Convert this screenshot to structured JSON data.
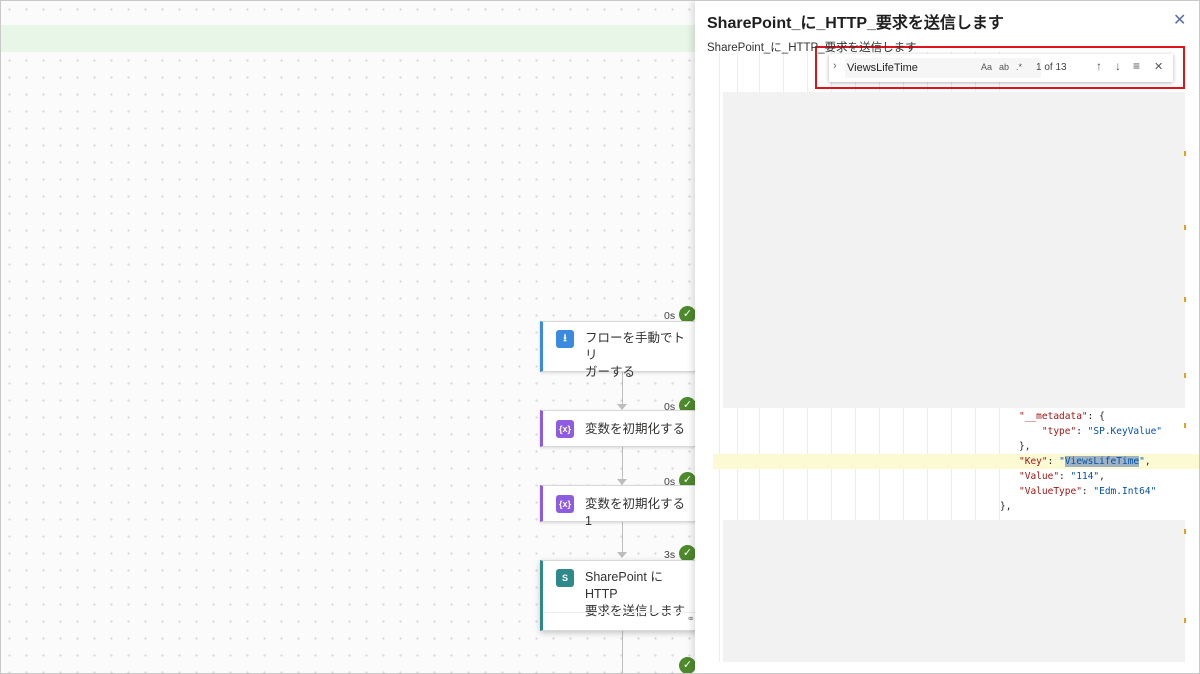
{
  "canvas": {
    "nodes": [
      {
        "id": "trigger",
        "label_line1": "フローを手動でトリ",
        "label_line2": "ガーする",
        "duration": "0s",
        "icon": "download-arrow-icon",
        "color": "#3a8be0"
      },
      {
        "id": "init1",
        "label_line1": "変数を初期化する",
        "duration": "0s",
        "icon": "variable-braces-icon",
        "color": "#8d5ce0"
      },
      {
        "id": "init2",
        "label_line1": "変数を初期化する 1",
        "duration": "0s",
        "icon": "variable-braces-icon",
        "color": "#8d5ce0"
      },
      {
        "id": "http",
        "label_line1": "SharePoint に HTTP",
        "label_line2": "要求を送信します",
        "duration": "3s",
        "icon": "sharepoint-icon",
        "color": "#2e8a8a"
      }
    ],
    "success_color": "#4d8a2c"
  },
  "panel": {
    "title": "SharePoint_に_HTTP_要求を送信します",
    "subtitle": "SharePoint_に_HTTP_要求を送信します",
    "close_glyph": "✕"
  },
  "find": {
    "toggle_glyph": "›",
    "query": "ViewsLifeTime",
    "match_case": "Aa",
    "whole_word": "ab",
    "regex": ".*",
    "count": "1 of 13",
    "prev": "↑",
    "next": "↓",
    "in_selection": "≡",
    "close": "✕"
  },
  "code": {
    "metadata_key": "\"__metadata\"",
    "colon_brace": ": {",
    "type_key": "\"type\"",
    "type_value": "\"SP.KeyValue\"",
    "close_brace_comma": "},",
    "key_key": "\"Key\"",
    "key_value_match": "ViewsLifeTime",
    "value_key": "\"Value\"",
    "value_value": "\"114\"",
    "valuetype_key": "\"ValueType\"",
    "valuetype_value": "\"Edm.Int64\""
  }
}
